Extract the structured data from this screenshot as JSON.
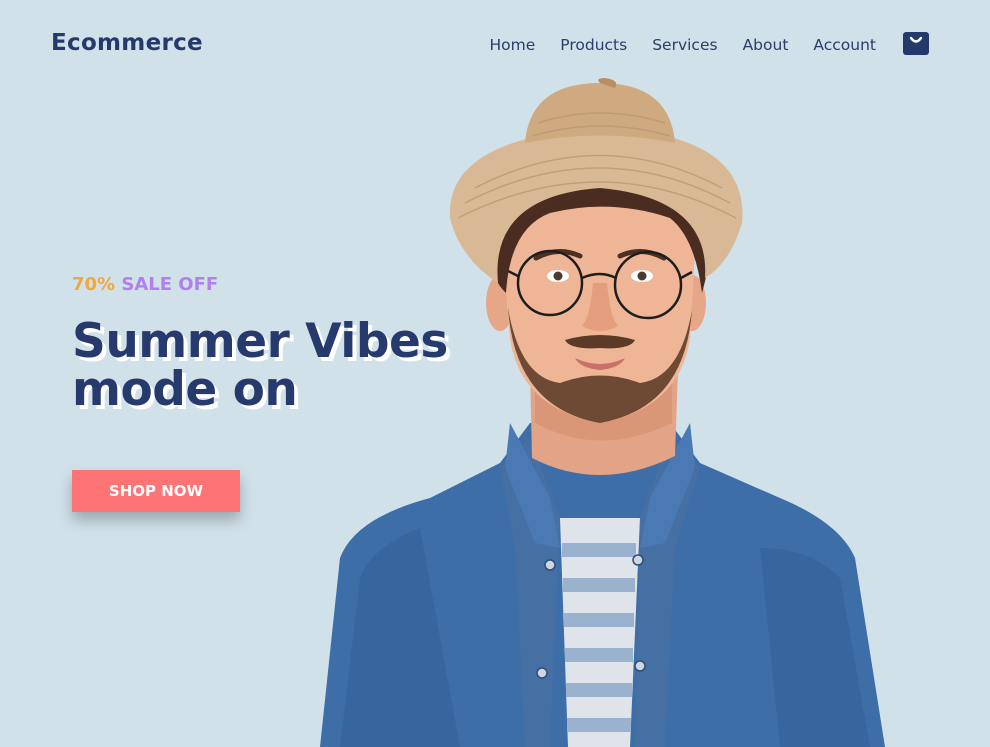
{
  "header": {
    "logo": "Ecommerce",
    "nav": [
      {
        "label": "Home"
      },
      {
        "label": "Products"
      },
      {
        "label": "Services"
      },
      {
        "label": "About"
      },
      {
        "label": "Account"
      }
    ],
    "cart_icon": "shopping-bag-icon"
  },
  "hero": {
    "sale_percent": "70%",
    "sale_text": "SALE OFF",
    "headline_line1": "Summer Vibes",
    "headline_line2": "mode on",
    "cta_label": "SHOP NOW"
  },
  "colors": {
    "background": "#d0e1e9",
    "primary_text": "#263a6d",
    "sale_orange": "#f3a63a",
    "sale_purple": "#b180f0",
    "cta": "#fe7373"
  }
}
